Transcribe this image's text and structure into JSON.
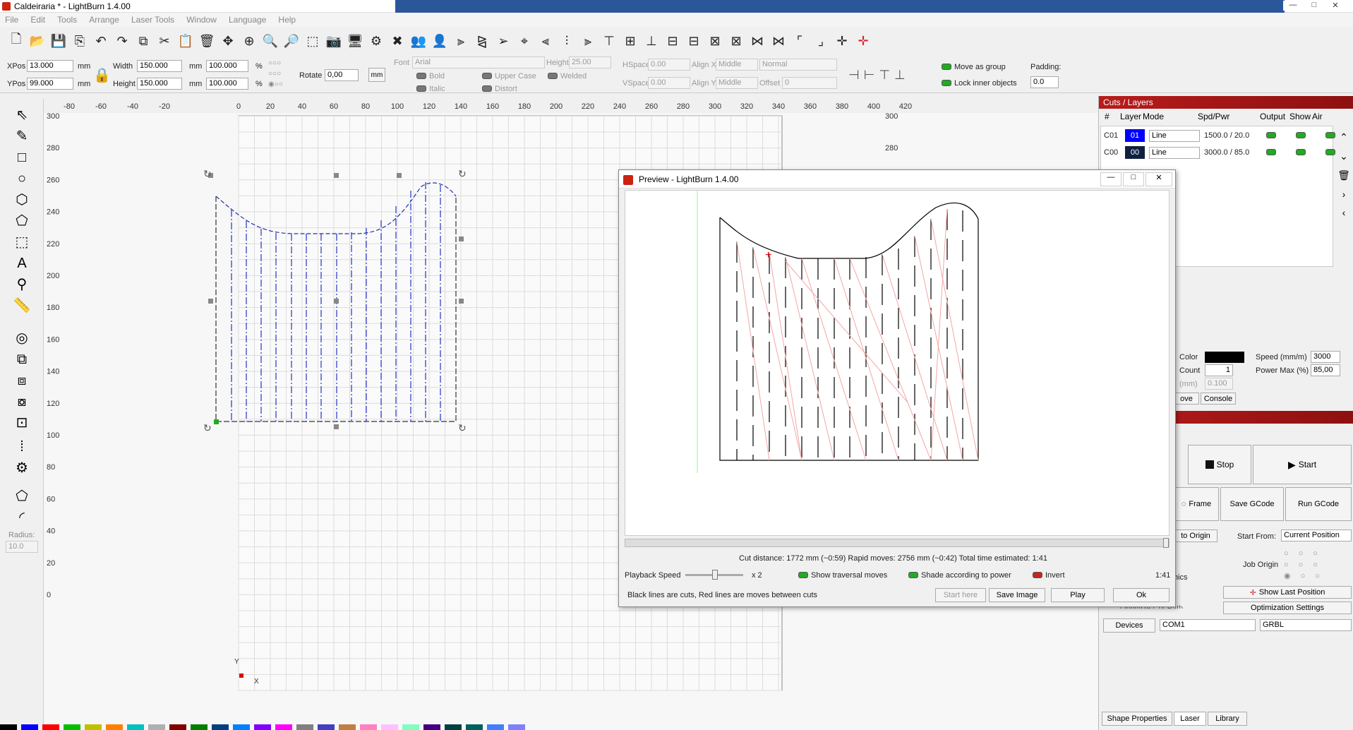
{
  "window": {
    "title": "Caldeiraria * - LightBurn 1.4.00",
    "buttons": [
      "—",
      "□",
      "✕"
    ]
  },
  "menu": [
    "File",
    "Edit",
    "Tools",
    "Arrange",
    "Laser Tools",
    "Window",
    "Language",
    "Help"
  ],
  "toolbar_icons": [
    "new-icon",
    "open-icon",
    "save-icon",
    "import-icon",
    "undo-icon",
    "redo-icon",
    "copy-icon",
    "cut-icon",
    "paste-icon",
    "delete-icon",
    "move-icon",
    "zoom-fit-icon",
    "zoom-in-icon",
    "zoom-out-icon",
    "select-frame-icon",
    "camera-icon",
    "monitor-icon",
    "settings-icon",
    "tools-icon",
    "group-icon",
    "user-icon",
    "flip-h-icon",
    "mirror-icon",
    "send-icon",
    "target-icon",
    "align-left-icon",
    "align-center-icon",
    "align-right-icon",
    "align-top-icon",
    "align-middle-icon",
    "align-bottom-icon",
    "distribute-h-icon",
    "distribute-v-icon",
    "dist-center-h-icon",
    "dist-center-v-icon",
    "space-h-icon",
    "space-v-icon",
    "corner-tl-icon",
    "corner-br-icon",
    "crosshair-icon",
    "red-crosshair-icon"
  ],
  "props": {
    "xpos_label": "XPos",
    "xpos": "13.000",
    "ypos_label": "YPos",
    "ypos": "99.000",
    "unit_mm": "mm",
    "width_label": "Width",
    "width": "150.000",
    "height_label": "Height",
    "height": "150.000",
    "pct_w": "100.000",
    "pct_h": "100.000",
    "pct": "%",
    "rotate_label": "Rotate",
    "rotate": "0,00",
    "mm_btn": "mm",
    "font_label": "Font",
    "font_value": "Arial",
    "font_height_label": "Height",
    "font_height": "25.00",
    "hspace_label": "HSpace",
    "hspace": "0.00",
    "vspace_label": "VSpace",
    "vspace": "0.00",
    "alignx_label": "Align X",
    "alignx": "Middle",
    "aligny_label": "Align Y",
    "aligny": "Middle",
    "style": "Normal",
    "offset_label": "Offset",
    "offset": "0",
    "bold": "Bold",
    "italic": "Italic",
    "upper": "Upper Case",
    "distort": "Distort",
    "welded": "Welded",
    "move_as_group": "Move as group",
    "lock_inner": "Lock inner objects",
    "padding_label": "Padding:",
    "padding": "0.0"
  },
  "left_tools": [
    "select-arrow-icon",
    "pen-icon",
    "rectangle-icon",
    "ellipse-icon",
    "polygon-icon",
    "pentagon-icon",
    "frame-icon",
    "text-icon",
    "position-icon",
    "measure-icon",
    "offset-icon",
    "boolean-union-icon",
    "boolean-subtract-icon",
    "boolean-intersect-icon",
    "weld-icon",
    "grid-array-icon",
    "circular-array-icon",
    "edit-nodes-icon",
    "corner-radius-icon"
  ],
  "radius": {
    "label": "Radius:",
    "value": "10.0"
  },
  "ruler": {
    "top": [
      "-80",
      "-60",
      "-40",
      "-20",
      "0",
      "20",
      "40",
      "60",
      "80",
      "100",
      "120",
      "140",
      "160",
      "180",
      "200",
      "220",
      "240",
      "260",
      "280",
      "300",
      "320",
      "340",
      "360",
      "380",
      "400",
      "420"
    ],
    "left": [
      "300",
      "280",
      "260",
      "240",
      "220",
      "200",
      "180",
      "160",
      "140",
      "120",
      "100",
      "80",
      "60",
      "40",
      "20",
      "0"
    ],
    "axis_x": "X",
    "axis_y": "Y"
  },
  "cuts": {
    "title": "Cuts / Layers",
    "headers": [
      "#",
      "Layer",
      "Mode",
      "Spd/Pwr",
      "Output",
      "Show",
      "Air"
    ],
    "rows": [
      {
        "id": "C01",
        "layer": "01",
        "mode": "Line",
        "spdpwr": "1500.0 / 20.0",
        "color": "#0000ff"
      },
      {
        "id": "C00",
        "layer": "00",
        "mode": "Line",
        "spdpwr": "3000.0 / 85.0",
        "color": "#0f2040"
      }
    ],
    "color_label": "Color",
    "speed_label": "Speed (mm/m)",
    "speed": "3000",
    "count_label": "Count",
    "count": "1",
    "power_label": "Power Max (%)",
    "power": "85,00",
    "interval_label": "(mm)",
    "interval": "0.100",
    "tabs": [
      "ove",
      "Console"
    ]
  },
  "laser": {
    "stop": "Stop",
    "start": "Start",
    "frame": "Frame",
    "save_gcode": "Save GCode",
    "run_gcode": "Run GCode",
    "to_origin": "to Origin",
    "start_from_label": "Start From:",
    "start_from": "Current Position",
    "job_origin": "Job Origin",
    "hics": "hics",
    "show_last": "Show Last Position",
    "opt_settings": "Optimization Settings",
    "opt_cut": "Optimize Cut Path",
    "devices": "Devices",
    "port": "COM1",
    "firmware": "GRBL"
  },
  "bottom_tabs": [
    "Shape Properties",
    "Laser",
    "Library"
  ],
  "preview": {
    "title": "Preview - LightBurn 1.4.00",
    "stats": "Cut distance: 1772 mm (~0:59)   Rapid moves: 2756 mm (~0:42)   Total time estimated: 1:41",
    "playback_label": "Playback Speed",
    "playback_mult": "x 2",
    "show_traversal": "Show traversal moves",
    "shade": "Shade according to power",
    "invert": "Invert",
    "time": "1:41",
    "legend": "Black lines are cuts, Red lines are moves between cuts",
    "start_here": "Start here",
    "save_image": "Save Image",
    "play": "Play",
    "ok": "Ok"
  },
  "palette": [
    "#000000",
    "#0000ff",
    "#ff0000",
    "#00c000",
    "#c0c000",
    "#ff8000",
    "#00c0c0",
    "#b0b0b0",
    "#800000",
    "#008000",
    "#004080",
    "#0080ff",
    "#8000ff",
    "#ff00ff",
    "#808080",
    "#4040c0",
    "#c08040",
    "#ff80c0",
    "#ffc0ff",
    "#80ffc0",
    "#400080",
    "#004040",
    "#006060",
    "#4080ff",
    "#8080ff"
  ],
  "accent": "#b71c1c"
}
